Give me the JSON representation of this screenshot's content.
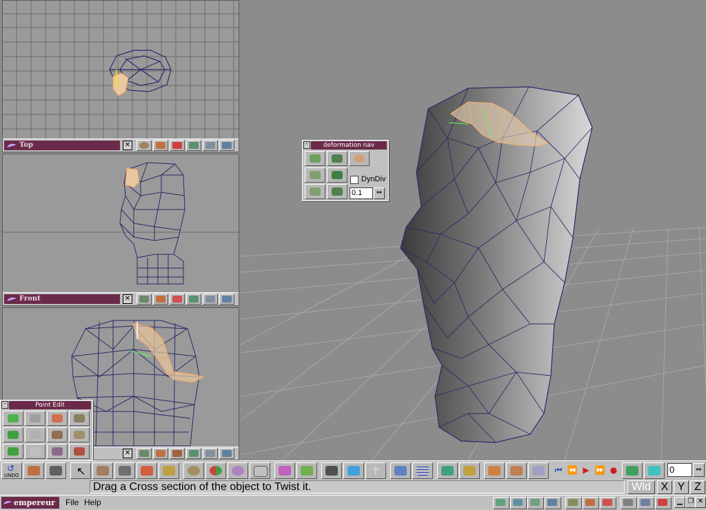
{
  "viewports": {
    "top": {
      "label": "Top",
      "close": "✕"
    },
    "front": {
      "label": "Front",
      "close": "✕"
    },
    "side": {
      "close": "✕"
    }
  },
  "deformation_nav": {
    "title": "deformation nav",
    "minimize": "–",
    "dyndiv_label": "DynDiv",
    "dyndiv_checked": false,
    "value": "0.1"
  },
  "point_edit": {
    "title": "Point Edit",
    "minimize": "–"
  },
  "toolbar": {
    "undo_label": "UNDO",
    "frame_value": "0"
  },
  "status": {
    "message": "Drag a Cross section of the object to Twist it.",
    "wld_label": "Wld",
    "x_label": "X",
    "y_label": "Y",
    "z_label": "Z"
  },
  "menubar": {
    "app_name": "empereur",
    "file_label": "File",
    "help_label": "Help"
  },
  "colors": {
    "viewport_bg": "#9a9a9a",
    "perspective_bg": "#8c8c8c",
    "title_bar": "#6b2a4a",
    "wireframe": "#2a2a6a",
    "selection": "#f0b070",
    "ui_face": "#c0c0c0"
  },
  "icons": {
    "toolbar": [
      "undo-icon",
      "cube-icon",
      "camera-icon",
      "pointer-icon",
      "move-icon",
      "cube-icon",
      "cube-icon",
      "box-icon",
      "sphere-icon",
      "half-sphere-icon",
      "blob-icon",
      "spline-icon",
      "funnel-icon",
      "cube-icon",
      "film-icon",
      "cube-icon",
      "figure-icon",
      "axes-icon",
      "grid-icon",
      "box-icon",
      "rotate-icon",
      "move-icon",
      "rotate-icon",
      "scale-icon"
    ],
    "playback": [
      "skip-start-icon",
      "rewind-icon",
      "play-icon",
      "fast-forward-icon",
      "record-icon"
    ]
  }
}
